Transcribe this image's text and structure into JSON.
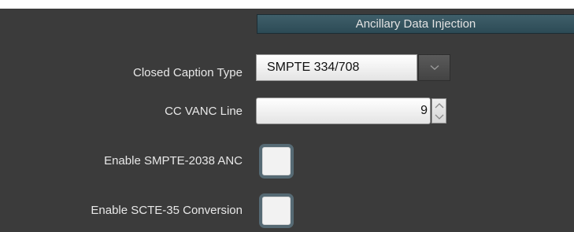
{
  "section": {
    "title": "Ancillary Data Injection"
  },
  "fields": {
    "closed_caption_type": {
      "label": "Closed Caption Type",
      "value": "SMPTE 334/708"
    },
    "cc_vanc_line": {
      "label": "CC VANC Line",
      "value": "9"
    },
    "enable_smpte_2038": {
      "label": "Enable SMPTE-2038 ANC",
      "checked": false
    },
    "enable_scte_35": {
      "label": "Enable SCTE-35 Conversion",
      "checked": false
    }
  },
  "icons": {
    "dropdown": "chevron-down-icon",
    "spin_up": "chevron-up-icon",
    "spin_down": "chevron-down-icon"
  },
  "colors": {
    "panel_background": "#3b3b3b",
    "header_background": "#34545f",
    "label_text": "#e8e8e8",
    "checkbox_border": "#566a74"
  }
}
